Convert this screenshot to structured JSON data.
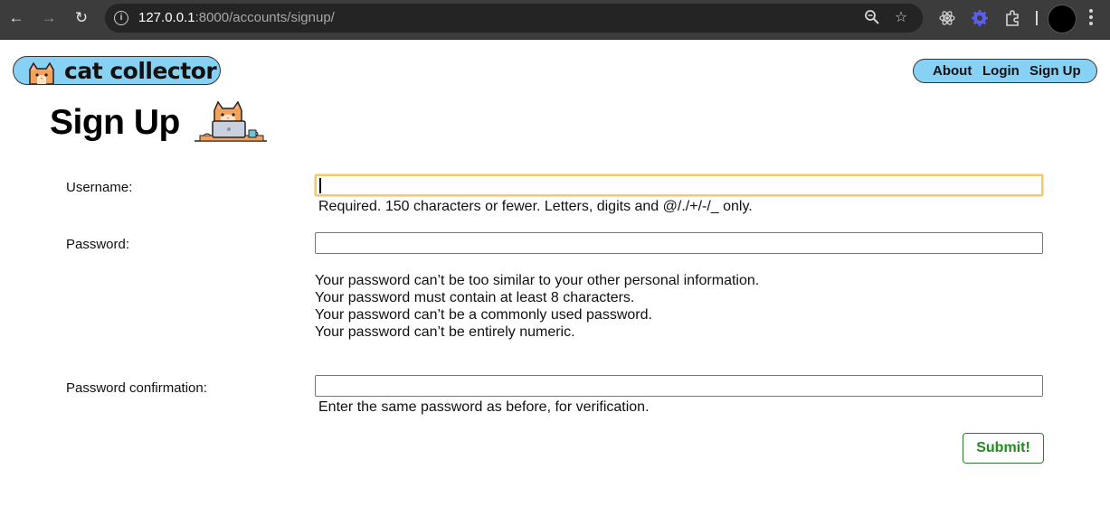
{
  "browser": {
    "url_host": "127.0.0.1",
    "url_rest": ":8000/accounts/signup/"
  },
  "site": {
    "logo_text": "cat collector",
    "nav": [
      {
        "label": "About"
      },
      {
        "label": "Login"
      },
      {
        "label": "Sign Up"
      }
    ]
  },
  "page": {
    "title": "Sign Up"
  },
  "form": {
    "username": {
      "label": "Username:",
      "value": "",
      "help": "Required. 150 characters or fewer. Letters, digits and @/./+/-/_ only."
    },
    "password": {
      "label": "Password:",
      "value": "",
      "rules": [
        "Your password can’t be too similar to your other personal information.",
        "Your password must contain at least 8 characters.",
        "Your password can’t be a commonly used password.",
        "Your password can’t be entirely numeric."
      ]
    },
    "password_confirmation": {
      "label": "Password confirmation:",
      "value": "",
      "help": "Enter the same password as before, for verification."
    },
    "submit_label": "Submit!"
  },
  "colors": {
    "nav_pill": "#87d1f4",
    "submit_text": "#218a21",
    "focus_ring": "#f5c86a"
  }
}
